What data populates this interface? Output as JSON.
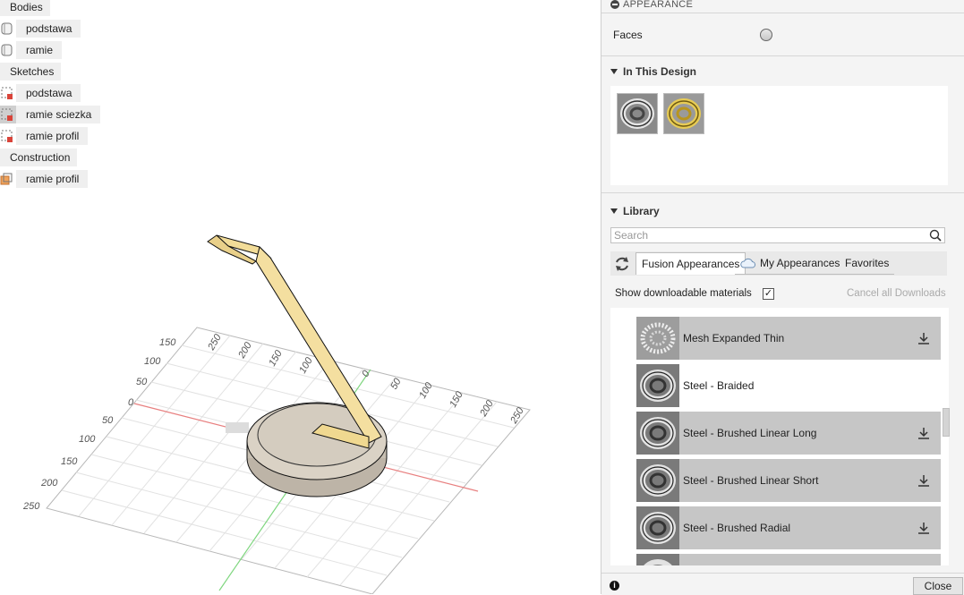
{
  "browser": {
    "bodies_label": "Bodies",
    "bodies": [
      "podstawa",
      "ramie"
    ],
    "sketches_label": "Sketches",
    "sketches": [
      "podstawa",
      "ramie sciezka",
      "ramie profil"
    ],
    "construction_label": "Construction",
    "construction": [
      "ramie profil"
    ]
  },
  "viewport": {
    "left_ticks": [
      "150",
      "100",
      "50",
      "0",
      "50",
      "100",
      "150",
      "200",
      "250"
    ],
    "top_ticks": [
      "250",
      "200",
      "150",
      "100",
      "0",
      "50",
      "100",
      "150",
      "200",
      "250"
    ]
  },
  "panel": {
    "header": "APPEARANCE",
    "faces_label": "Faces",
    "in_this_design": "In This Design",
    "library": "Library",
    "search_placeholder": "Search",
    "tabs": [
      "Fusion Appearances",
      "My Appearances",
      "Favorites"
    ],
    "show_downloadable": "Show downloadable materials",
    "checkbox_mark": "✓",
    "cancel_downloads": "Cancel all Downloads",
    "materials": [
      {
        "name": "Mesh Expanded Thin",
        "downloadable": true
      },
      {
        "name": "Steel - Braided",
        "downloadable": false
      },
      {
        "name": "Steel - Brushed Linear Long",
        "downloadable": true
      },
      {
        "name": "Steel - Brushed Linear Short",
        "downloadable": true
      },
      {
        "name": "Steel - Brushed Radial",
        "downloadable": true
      }
    ],
    "info": "i",
    "close": "Close"
  },
  "colors": {
    "arm": "#f2dc98",
    "base_top": "#d7cfc3",
    "axis_red": "#e88080",
    "axis_green": "#7fd67f"
  }
}
